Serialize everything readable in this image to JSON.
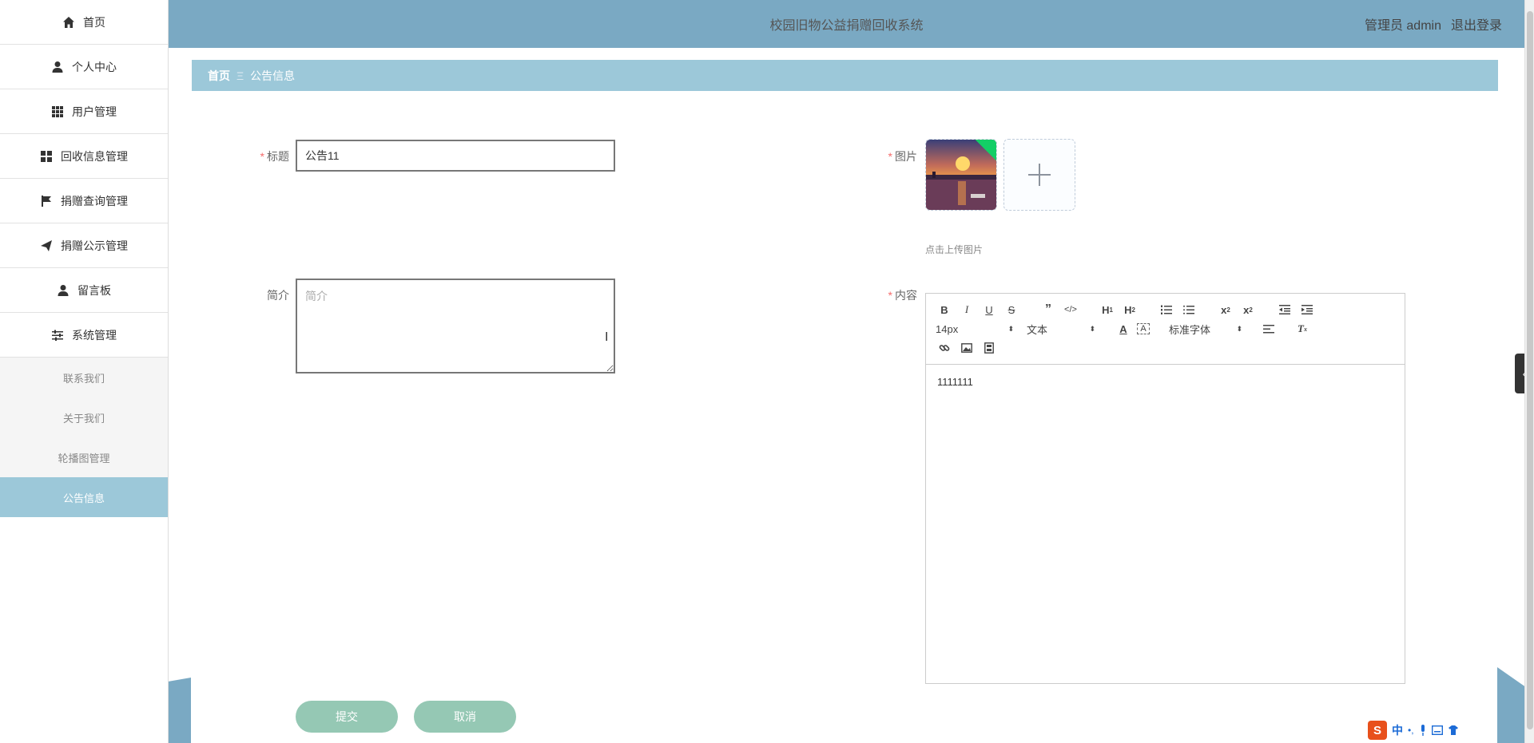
{
  "sidebar": {
    "items": [
      {
        "label": "首页",
        "icon": "home-icon"
      },
      {
        "label": "个人中心",
        "icon": "user-icon"
      },
      {
        "label": "用户管理",
        "icon": "grid-icon"
      },
      {
        "label": "回收信息管理",
        "icon": "apps-icon"
      },
      {
        "label": "捐赠查询管理",
        "icon": "flag-icon"
      },
      {
        "label": "捐赠公示管理",
        "icon": "send-icon"
      },
      {
        "label": "留言板",
        "icon": "person-icon"
      },
      {
        "label": "系统管理",
        "icon": "sliders-icon"
      }
    ],
    "sub_items": [
      {
        "label": "联系我们",
        "active": false
      },
      {
        "label": "关于我们",
        "active": false
      },
      {
        "label": "轮播图管理",
        "active": false
      },
      {
        "label": "公告信息",
        "active": true
      }
    ]
  },
  "header": {
    "title": "校园旧物公益捐赠回收系统",
    "user": "管理员 admin",
    "logout": "退出登录"
  },
  "breadcrumb": {
    "home": "首页",
    "separator": "Ξ",
    "current": "公告信息"
  },
  "form": {
    "title_label": "标题",
    "title_value": "公告11",
    "image_label": "图片",
    "upload_hint": "点击上传图片",
    "intro_label": "简介",
    "intro_placeholder": "简介",
    "content_label": "内容",
    "content_text": "1111111",
    "submit": "提交",
    "cancel": "取消"
  },
  "editor": {
    "font_size": "14px",
    "block_type": "文本",
    "font_family": "标准字体"
  },
  "ime": {
    "logo": "S",
    "mode": "中"
  },
  "colors": {
    "header_bg": "#7aa9c3",
    "breadcrumb_bg": "#9cc8d9",
    "button_bg": "#95c8b4",
    "required": "#f56c6c"
  }
}
